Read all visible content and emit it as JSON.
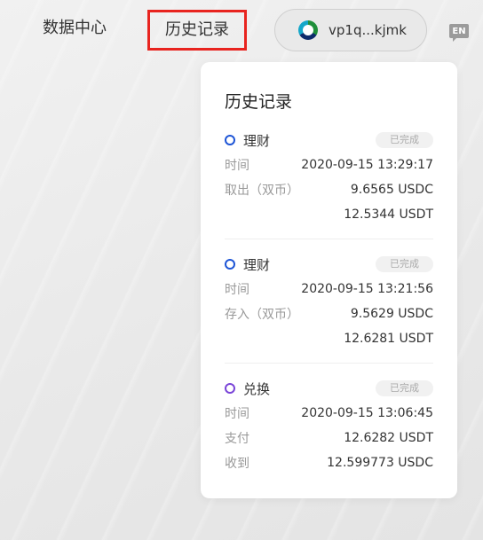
{
  "nav": {
    "data_center": "数据中心",
    "history": "历史记录"
  },
  "wallet": {
    "address": "vp1q...kjmk"
  },
  "language": "EN",
  "history_panel": {
    "title": "历史记录",
    "entries": [
      {
        "type": "理财",
        "status": "已完成",
        "time_label": "时间",
        "time": "2020-09-15 13:29:17",
        "action_label": "取出（双币）",
        "amount1": "9.6565 USDC",
        "amount2": "12.5344 USDT"
      },
      {
        "type": "理财",
        "status": "已完成",
        "time_label": "时间",
        "time": "2020-09-15 13:21:56",
        "action_label": "存入（双币）",
        "amount1": "9.5629 USDC",
        "amount2": "12.6281 USDT"
      },
      {
        "type": "兑换",
        "status": "已完成",
        "time_label": "时间",
        "time": "2020-09-15 13:06:45",
        "pay_label": "支付",
        "pay_amount": "12.6282 USDT",
        "receive_label": "收到",
        "receive_amount": "12.599773 USDC"
      }
    ]
  },
  "colors": {
    "highlight_border": "#e8241f",
    "finance_dot": "#1e55d6",
    "swap_dot": "#7a45d8"
  }
}
